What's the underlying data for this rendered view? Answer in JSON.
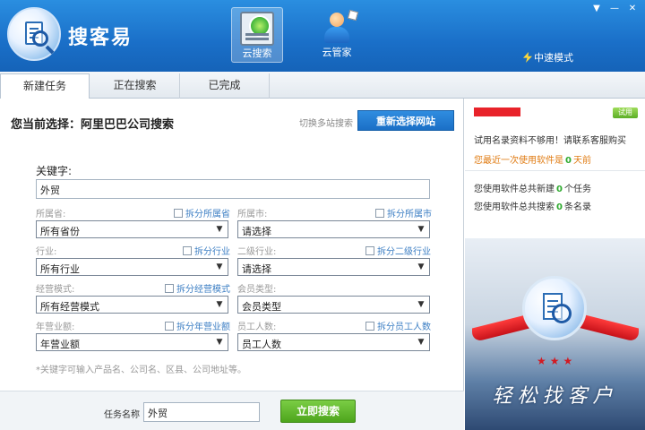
{
  "app": {
    "title": "搜客易",
    "nav": [
      {
        "label": "云搜索",
        "icon": "cloud-search-icon"
      },
      {
        "label": "云管家",
        "icon": "cloud-manager-icon"
      }
    ],
    "speed_mode": "中速模式",
    "window_controls": [
      "▼",
      "—",
      "✕"
    ]
  },
  "tabs": [
    "新建任务",
    "正在搜索",
    "已完成"
  ],
  "main": {
    "current_selection": "您当前选择：阿里巴巴公司搜索",
    "switch_link": "切换多站搜索",
    "reselect_button": "重新选择网站",
    "keyword_label": "关键字:",
    "keyword_value": "外贸",
    "fields": {
      "province": {
        "label": "所属省:",
        "split": "拆分所属省",
        "value": "所有省份"
      },
      "city": {
        "label": "所属市:",
        "split": "拆分所属市",
        "value": "请选择"
      },
      "industry": {
        "label": "行业:",
        "split": "拆分行业",
        "value": "所有行业"
      },
      "sub_industry": {
        "label": "二级行业:",
        "split": "拆分二级行业",
        "value": "请选择"
      },
      "business_mode": {
        "label": "经营模式:",
        "split": "拆分经营模式",
        "value": "所有经营模式"
      },
      "member_type": {
        "label": "会员类型:",
        "split": "",
        "value": "会员类型"
      },
      "revenue": {
        "label": "年营业额:",
        "split": "拆分年营业额",
        "value": "年营业额"
      },
      "employees": {
        "label": "员工人数:",
        "split": "拆分员工人数",
        "value": "员工人数"
      }
    },
    "hint": "*关键字可输入产品名、公司名、区县、公司地址等。",
    "task_label": "任务名称",
    "task_value": "外贸",
    "search_button": "立即搜索"
  },
  "right": {
    "trial_badge": "试用",
    "line1": "试用名录资料不够用！请联系客服购买",
    "line2_prefix": "您最近一次使用软件是",
    "line2_num": "0",
    "line2_suffix": "天前",
    "line3_prefix": "您使用软件总共新建",
    "line3_num": "0",
    "line3_suffix": "个任务",
    "line4_prefix": "您使用软件总共搜索",
    "line4_num": "0",
    "line4_suffix": "条名录",
    "promo_stars": "★★★",
    "promo_slogan": "轻松找客户"
  }
}
